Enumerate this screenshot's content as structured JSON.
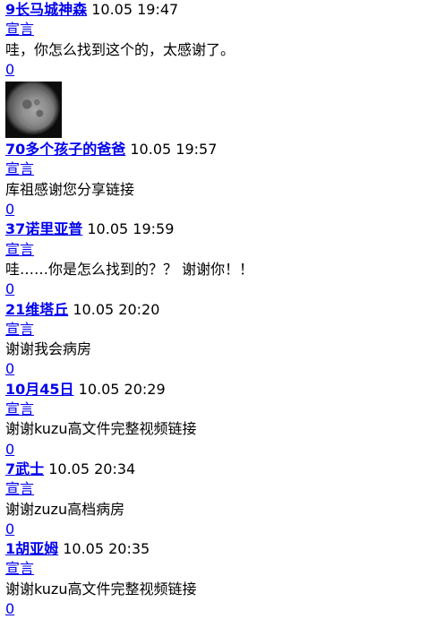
{
  "comments": [
    {
      "user": "9长马城神森",
      "time": "10.05 19:47",
      "action": "宣言",
      "text": "哇，你怎么找到这个的，太感谢了。",
      "count": "0",
      "has_image": true
    },
    {
      "user": "70多个孩子的爸爸",
      "time": "10.05 19:57",
      "action": "宣言",
      "text": "库祖感谢您分享链接",
      "count": "0",
      "has_image": false
    },
    {
      "user": "37诺里亚普",
      "time": "10.05 19:59",
      "action": "宣言",
      "text": "哇……你是怎么找到的？？ 谢谢你！！",
      "count": "0",
      "has_image": false
    },
    {
      "user": "21维塔丘",
      "time": "10.05 20:20",
      "action": "宣言",
      "text": "谢谢我会病房",
      "count": "0",
      "has_image": false
    },
    {
      "user": "10月45日",
      "time": "10.05 20:29",
      "action": "宣言",
      "text": "谢谢kuzu高文件完整视频链接",
      "count": "0",
      "has_image": false
    },
    {
      "user": "7武士",
      "time": "10.05 20:34",
      "action": "宣言",
      "text": "谢谢zuzu高档病房",
      "count": "0",
      "has_image": false
    },
    {
      "user": "1胡亚姆",
      "time": "10.05 20:35",
      "action": "宣言",
      "text": "谢谢kuzu高文件完整视频链接",
      "count": "0",
      "has_image": false
    }
  ],
  "image": {
    "icon": "moon-image"
  }
}
